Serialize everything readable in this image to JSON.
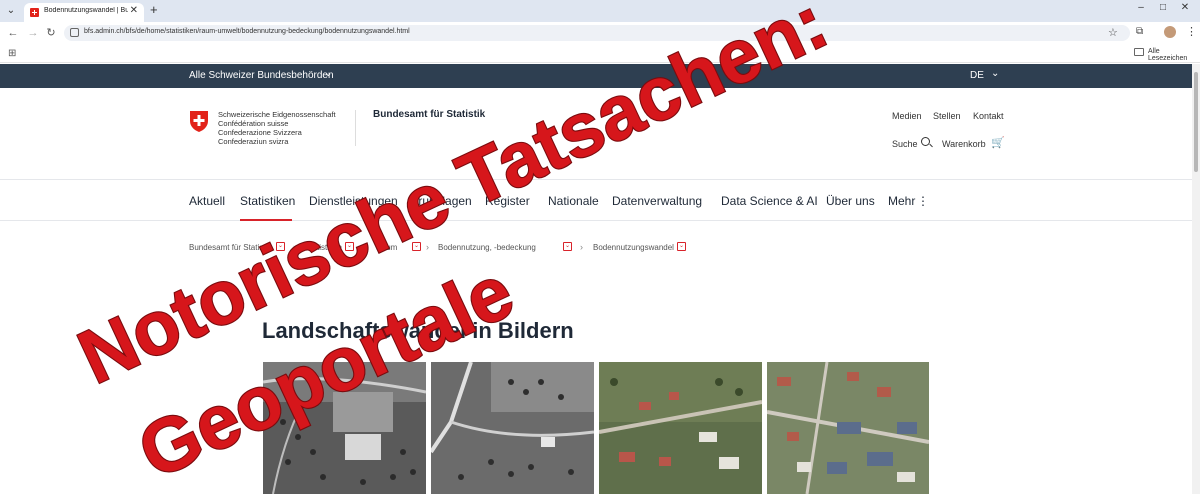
{
  "browser": {
    "tab_title": "Bodennutzungswandel | Bunde",
    "tab_close": "✕",
    "new_tab": "+",
    "url": "bfs.admin.ch/bfs/de/home/statistiken/raum-umwelt/bodennutzung-bedeckung/bodennutzungswandel.html",
    "bookmarks_folder": "Alle Lesezeichen",
    "icons": [
      "tab-search-icon",
      "back-icon",
      "forward-icon",
      "reload-icon",
      "site-info-icon",
      "star-icon",
      "extensions-icon",
      "profile-icon",
      "kebab-menu-icon",
      "apps-icon",
      "folder-icon"
    ]
  },
  "topbar": {
    "authorities": "Alle Schweizer Bundesbehörden",
    "language": "DE"
  },
  "header": {
    "org_lines": [
      "Schweizerische Eidgenossenschaft",
      "Confédération suisse",
      "Confederazione Svizzera",
      "Confederaziun svizra"
    ],
    "office": "Bundesamt für Statistik",
    "util_links": [
      "Medien",
      "Stellen",
      "Kontakt"
    ],
    "search": "Suche",
    "cart": "Warenkorb"
  },
  "main_nav": {
    "items": [
      "Aktuell",
      "Statistiken",
      "Dienstleistungen",
      "Grundlagen",
      "Register",
      "Nationale",
      "Datenverwaltung",
      "Data Science & AI",
      "Über uns",
      "Mehr"
    ],
    "more_icon": "⋮",
    "active": "Statistiken"
  },
  "breadcrumbs": [
    "Bundesamt für Statistik",
    "Statistiken",
    "Raum",
    "Bodennutzung, -bedeckung",
    "Bodennutzungswandel"
  ],
  "page": {
    "title": "Landschaftswandel in Bildern"
  },
  "overlay": {
    "line1": "Notorische Tatsachen:",
    "line2": "Geoportale",
    "color": "#d6161b"
  },
  "colors": {
    "topbar": "#2e3f51",
    "accent": "#d8232a"
  }
}
